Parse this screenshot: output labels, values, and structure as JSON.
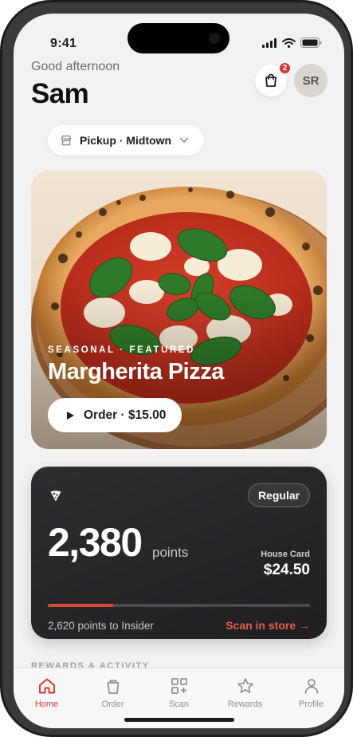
{
  "status_bar": {
    "time": "9:41"
  },
  "header": {
    "greeting": "Good afternoon",
    "name": "Sam",
    "cart_count": "2",
    "avatar_initials": "SR"
  },
  "pickup": {
    "label": "Pickup · Midtown"
  },
  "hero": {
    "eyebrow": "SEASONAL · FEATURED",
    "title": "Margherita Pizza",
    "order_label": "Order · $15.00"
  },
  "loyalty": {
    "tier": "Regular",
    "points": "2,380",
    "points_unit": "points",
    "house_card_label": "House Card",
    "house_card_value": "$24.50",
    "progress_fraction": 0.25,
    "progress_note": "2,620 points to Insider",
    "scan_label": "Scan in store →"
  },
  "section_peek": "REWARDS & ACTIVITY",
  "tabs": [
    {
      "label": "Home",
      "icon": "home-icon",
      "active": true
    },
    {
      "label": "Order",
      "icon": "bag-icon",
      "active": false
    },
    {
      "label": "Scan",
      "icon": "qr-scan-icon",
      "active": false
    },
    {
      "label": "Rewards",
      "icon": "star-icon",
      "active": false
    },
    {
      "label": "Profile",
      "icon": "person-icon",
      "active": false
    }
  ],
  "colors": {
    "accent": "#d9372b",
    "card_dark": "#2a2a2d",
    "background": "#f2f2f4"
  }
}
